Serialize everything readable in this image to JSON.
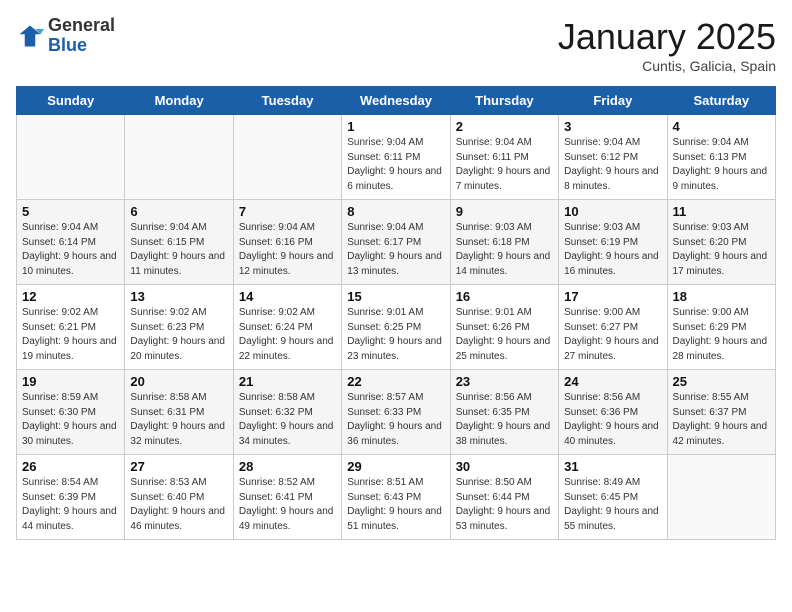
{
  "header": {
    "logo_line1": "General",
    "logo_line2": "Blue",
    "month": "January 2025",
    "location": "Cuntis, Galicia, Spain"
  },
  "weekdays": [
    "Sunday",
    "Monday",
    "Tuesday",
    "Wednesday",
    "Thursday",
    "Friday",
    "Saturday"
  ],
  "weeks": [
    [
      {
        "day": "",
        "text": ""
      },
      {
        "day": "",
        "text": ""
      },
      {
        "day": "",
        "text": ""
      },
      {
        "day": "1",
        "text": "Sunrise: 9:04 AM\nSunset: 6:11 PM\nDaylight: 9 hours and 6 minutes."
      },
      {
        "day": "2",
        "text": "Sunrise: 9:04 AM\nSunset: 6:11 PM\nDaylight: 9 hours and 7 minutes."
      },
      {
        "day": "3",
        "text": "Sunrise: 9:04 AM\nSunset: 6:12 PM\nDaylight: 9 hours and 8 minutes."
      },
      {
        "day": "4",
        "text": "Sunrise: 9:04 AM\nSunset: 6:13 PM\nDaylight: 9 hours and 9 minutes."
      }
    ],
    [
      {
        "day": "5",
        "text": "Sunrise: 9:04 AM\nSunset: 6:14 PM\nDaylight: 9 hours and 10 minutes."
      },
      {
        "day": "6",
        "text": "Sunrise: 9:04 AM\nSunset: 6:15 PM\nDaylight: 9 hours and 11 minutes."
      },
      {
        "day": "7",
        "text": "Sunrise: 9:04 AM\nSunset: 6:16 PM\nDaylight: 9 hours and 12 minutes."
      },
      {
        "day": "8",
        "text": "Sunrise: 9:04 AM\nSunset: 6:17 PM\nDaylight: 9 hours and 13 minutes."
      },
      {
        "day": "9",
        "text": "Sunrise: 9:03 AM\nSunset: 6:18 PM\nDaylight: 9 hours and 14 minutes."
      },
      {
        "day": "10",
        "text": "Sunrise: 9:03 AM\nSunset: 6:19 PM\nDaylight: 9 hours and 16 minutes."
      },
      {
        "day": "11",
        "text": "Sunrise: 9:03 AM\nSunset: 6:20 PM\nDaylight: 9 hours and 17 minutes."
      }
    ],
    [
      {
        "day": "12",
        "text": "Sunrise: 9:02 AM\nSunset: 6:21 PM\nDaylight: 9 hours and 19 minutes."
      },
      {
        "day": "13",
        "text": "Sunrise: 9:02 AM\nSunset: 6:23 PM\nDaylight: 9 hours and 20 minutes."
      },
      {
        "day": "14",
        "text": "Sunrise: 9:02 AM\nSunset: 6:24 PM\nDaylight: 9 hours and 22 minutes."
      },
      {
        "day": "15",
        "text": "Sunrise: 9:01 AM\nSunset: 6:25 PM\nDaylight: 9 hours and 23 minutes."
      },
      {
        "day": "16",
        "text": "Sunrise: 9:01 AM\nSunset: 6:26 PM\nDaylight: 9 hours and 25 minutes."
      },
      {
        "day": "17",
        "text": "Sunrise: 9:00 AM\nSunset: 6:27 PM\nDaylight: 9 hours and 27 minutes."
      },
      {
        "day": "18",
        "text": "Sunrise: 9:00 AM\nSunset: 6:29 PM\nDaylight: 9 hours and 28 minutes."
      }
    ],
    [
      {
        "day": "19",
        "text": "Sunrise: 8:59 AM\nSunset: 6:30 PM\nDaylight: 9 hours and 30 minutes."
      },
      {
        "day": "20",
        "text": "Sunrise: 8:58 AM\nSunset: 6:31 PM\nDaylight: 9 hours and 32 minutes."
      },
      {
        "day": "21",
        "text": "Sunrise: 8:58 AM\nSunset: 6:32 PM\nDaylight: 9 hours and 34 minutes."
      },
      {
        "day": "22",
        "text": "Sunrise: 8:57 AM\nSunset: 6:33 PM\nDaylight: 9 hours and 36 minutes."
      },
      {
        "day": "23",
        "text": "Sunrise: 8:56 AM\nSunset: 6:35 PM\nDaylight: 9 hours and 38 minutes."
      },
      {
        "day": "24",
        "text": "Sunrise: 8:56 AM\nSunset: 6:36 PM\nDaylight: 9 hours and 40 minutes."
      },
      {
        "day": "25",
        "text": "Sunrise: 8:55 AM\nSunset: 6:37 PM\nDaylight: 9 hours and 42 minutes."
      }
    ],
    [
      {
        "day": "26",
        "text": "Sunrise: 8:54 AM\nSunset: 6:39 PM\nDaylight: 9 hours and 44 minutes."
      },
      {
        "day": "27",
        "text": "Sunrise: 8:53 AM\nSunset: 6:40 PM\nDaylight: 9 hours and 46 minutes."
      },
      {
        "day": "28",
        "text": "Sunrise: 8:52 AM\nSunset: 6:41 PM\nDaylight: 9 hours and 49 minutes."
      },
      {
        "day": "29",
        "text": "Sunrise: 8:51 AM\nSunset: 6:43 PM\nDaylight: 9 hours and 51 minutes."
      },
      {
        "day": "30",
        "text": "Sunrise: 8:50 AM\nSunset: 6:44 PM\nDaylight: 9 hours and 53 minutes."
      },
      {
        "day": "31",
        "text": "Sunrise: 8:49 AM\nSunset: 6:45 PM\nDaylight: 9 hours and 55 minutes."
      },
      {
        "day": "",
        "text": ""
      }
    ]
  ]
}
